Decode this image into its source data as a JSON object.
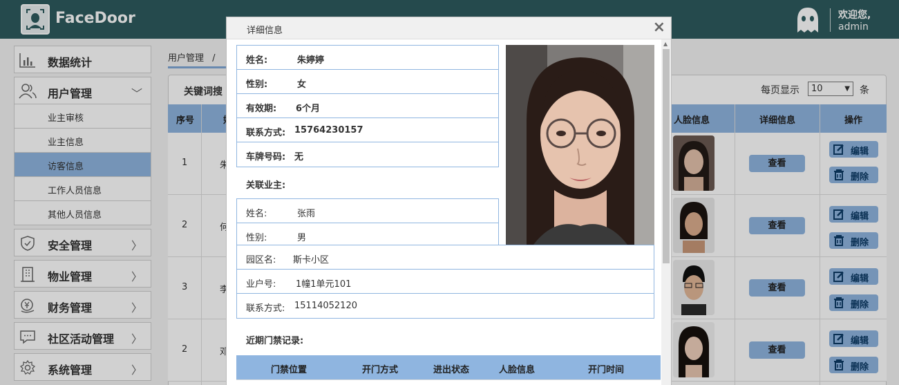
{
  "app": {
    "name": "FaceDoor",
    "welcome": "欢迎您,",
    "username": "admin"
  },
  "sidebar": {
    "items": [
      {
        "label": "数据统计",
        "icon": "bar-chart-icon"
      },
      {
        "label": "用户管理",
        "icon": "users-icon",
        "chevron": "﹀"
      },
      {
        "label": "安全管理",
        "icon": "shield-icon",
        "chevron": "〉"
      },
      {
        "label": "物业管理",
        "icon": "building-icon",
        "chevron": "〉"
      },
      {
        "label": "财务管理",
        "icon": "money-icon",
        "chevron": "〉"
      },
      {
        "label": "社区活动管理",
        "icon": "chat-icon",
        "chevron": "〉"
      },
      {
        "label": "系统管理",
        "icon": "gear-icon",
        "chevron": "〉"
      }
    ],
    "user_sub": [
      "业主审核",
      "业主信息",
      "访客信息",
      "工作人员信息",
      "其他人员信息"
    ],
    "active_sub": "访客信息"
  },
  "breadcrumb": {
    "first": "用户管理",
    "sep": "/"
  },
  "toolbar": {
    "keyword_label": "关键词搜",
    "perpage_label": "每页显示",
    "perpage_value": "10",
    "perpage_unit": "条"
  },
  "table": {
    "headers": {
      "no": "序号",
      "name": "姓",
      "face": "人脸信息",
      "detail": "详细信息",
      "op": "操作"
    },
    "rows": [
      {
        "no": "1",
        "name": "朱"
      },
      {
        "no": "2",
        "name": "何"
      },
      {
        "no": "3",
        "name": "李"
      },
      {
        "no": "2",
        "name": "邓"
      }
    ],
    "view_label": "查看",
    "edit_label": "编辑",
    "delete_label": "删除"
  },
  "modal": {
    "title": "详细信息",
    "close": "×",
    "visitor": [
      {
        "k": "姓名:",
        "v": "朱婷婷"
      },
      {
        "k": "性别:",
        "v": "女"
      },
      {
        "k": "有效期:",
        "v": "6个月"
      },
      {
        "k": "联系方式:",
        "v": "15764230157"
      },
      {
        "k": "车牌号码:",
        "v": "无"
      }
    ],
    "owner_section": "关联业主:",
    "owner": [
      {
        "k": "姓名:",
        "v": "张雨"
      },
      {
        "k": "性别:",
        "v": "男"
      }
    ],
    "owner_wide": [
      {
        "k": "园区名:",
        "v": "斯卡小区"
      },
      {
        "k": "业户号:",
        "v": "1幢1单元101"
      },
      {
        "k": "联系方式:",
        "v": "15114052120"
      }
    ],
    "records_section": "近期门禁记录:",
    "records_headers": [
      "门禁位置",
      "开门方式",
      "进出状态",
      "人脸信息",
      "开门时间"
    ]
  },
  "colors": {
    "header": "#2e5b5e",
    "accent": "#8fb5e0",
    "button_text": "#0d3b66"
  }
}
